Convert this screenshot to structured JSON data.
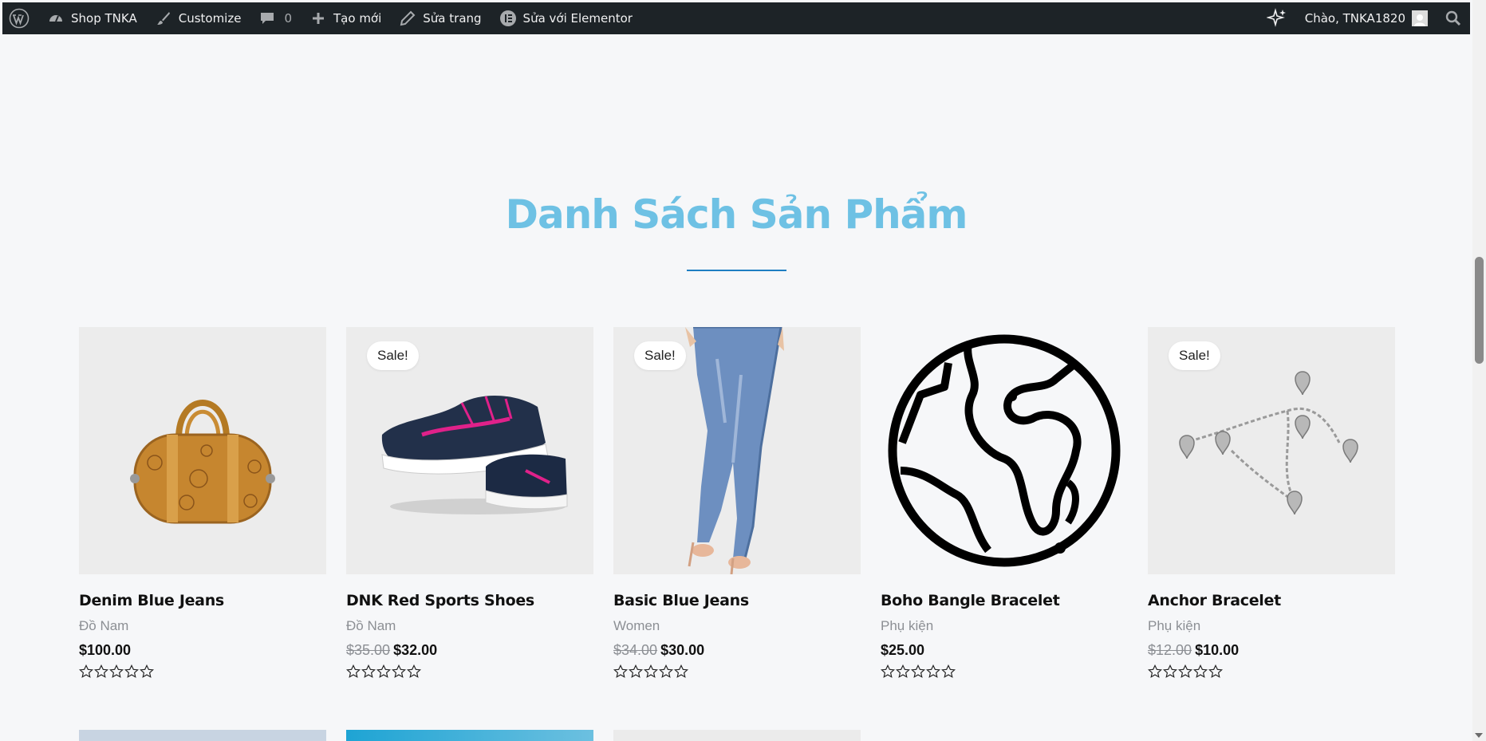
{
  "adminbar": {
    "site_name": "Shop TNKA",
    "customize": "Customize",
    "comments_count": "0",
    "new": "Tạo mới",
    "edit_page": "Sửa trang",
    "edit_elementor": "Sửa với Elementor",
    "greeting": "Chào, TNKA1820"
  },
  "section": {
    "title": "Danh Sách Sản Phẩm"
  },
  "products": [
    {
      "name": "Denim Blue Jeans",
      "category": "Đồ Nam",
      "price": "$100.00",
      "old_price": "",
      "sale": "",
      "image": "leather-bag"
    },
    {
      "name": "DNK Red Sports Shoes",
      "category": "Đồ Nam",
      "price": "$32.00",
      "old_price": "$35.00",
      "sale": "Sale!",
      "image": "sports-shoes"
    },
    {
      "name": "Basic Blue Jeans",
      "category": "Women",
      "price": "$30.00",
      "old_price": "$34.00",
      "sale": "Sale!",
      "image": "jeans-legs"
    },
    {
      "name": "Boho Bangle Bracelet",
      "category": "Phụ kiện",
      "price": "$25.00",
      "old_price": "",
      "sale": "",
      "image": "globe-icon"
    },
    {
      "name": "Anchor Bracelet",
      "category": "Phụ kiện",
      "price": "$10.00",
      "old_price": "$12.00",
      "sale": "Sale!",
      "image": "heart-bracelet"
    }
  ],
  "colors": {
    "heading": "#6ec1e4",
    "divider": "#1e7ec2",
    "adminbar": "#1d2327"
  }
}
